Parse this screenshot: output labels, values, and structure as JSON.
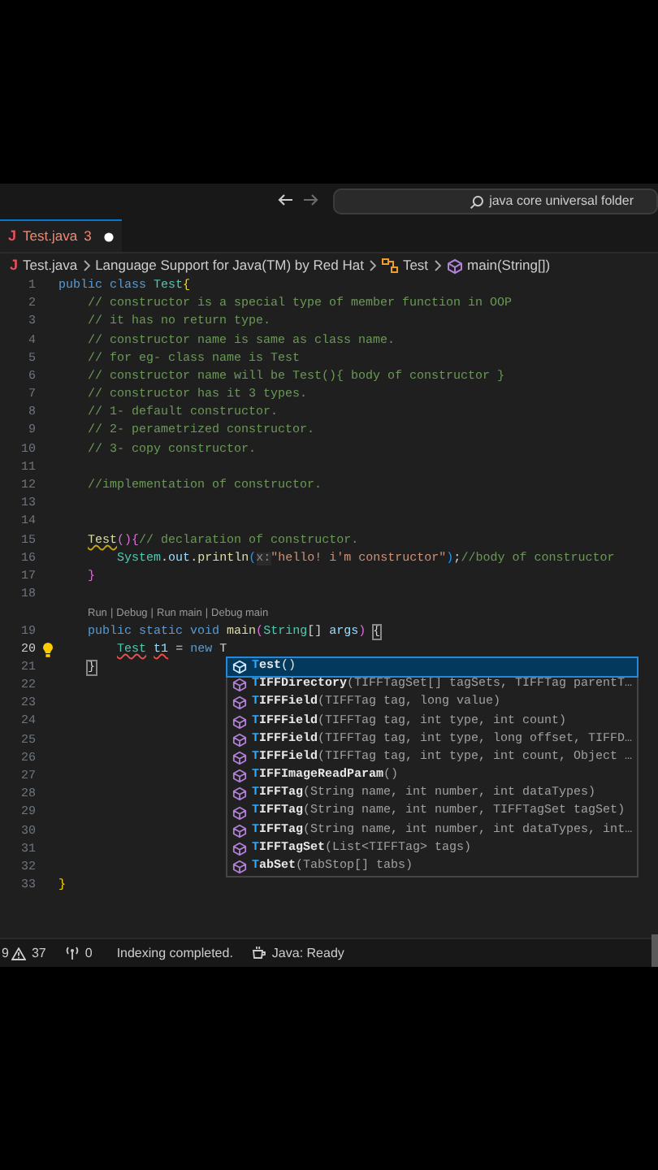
{
  "title_bar": {
    "nav": [
      {
        "kind": "back",
        "disabled": false
      },
      {
        "kind": "forward",
        "disabled": true
      }
    ],
    "search": {
      "value": "java core universal folder"
    }
  },
  "tabs": [
    {
      "icon_glyph": "J",
      "label": "Test.java",
      "badge": "3",
      "modified": true,
      "selected": true
    }
  ],
  "breadcrumb": [
    {
      "kind": "file",
      "icon_glyph": "J",
      "text": "Test.java"
    },
    {
      "kind": "text",
      "text": "Language Support for Java(TM) by Red Hat"
    },
    {
      "kind": "class",
      "text": "Test"
    },
    {
      "kind": "method",
      "text": "main(String[])"
    }
  ],
  "editor": {
    "lines": [
      {
        "kind": "code",
        "number": "1",
        "current": false,
        "lightbulb": false,
        "tokens": [
          {
            "text": "public class ",
            "kind": "keyword"
          },
          {
            "text": "Test",
            "kind": "type"
          },
          {
            "text": "{",
            "kind": "brace1"
          }
        ]
      },
      {
        "kind": "code",
        "number": "2",
        "current": false,
        "lightbulb": false,
        "tokens": [
          {
            "text": "    // constructor is a special type of member function in OOP",
            "kind": "comment"
          }
        ]
      },
      {
        "kind": "code",
        "number": "3",
        "current": false,
        "lightbulb": false,
        "tokens": [
          {
            "text": "    // it has no return type.",
            "kind": "comment"
          }
        ]
      },
      {
        "kind": "code",
        "number": "4",
        "current": false,
        "lightbulb": false,
        "tokens": [
          {
            "text": "    // constructor name is same as class name.",
            "kind": "comment"
          }
        ]
      },
      {
        "kind": "code",
        "number": "5",
        "current": false,
        "lightbulb": false,
        "tokens": [
          {
            "text": "    // for eg- class name is Test",
            "kind": "comment"
          }
        ]
      },
      {
        "kind": "code",
        "number": "6",
        "current": false,
        "lightbulb": false,
        "tokens": [
          {
            "text": "    // constructor name will be Test(){ body of constructor }",
            "kind": "comment"
          }
        ]
      },
      {
        "kind": "code",
        "number": "7",
        "current": false,
        "lightbulb": false,
        "tokens": [
          {
            "text": "    // constructor has it 3 types.",
            "kind": "comment"
          }
        ]
      },
      {
        "kind": "code",
        "number": "8",
        "current": false,
        "lightbulb": false,
        "tokens": [
          {
            "text": "    // 1- default constructor.",
            "kind": "comment"
          }
        ]
      },
      {
        "kind": "code",
        "number": "9",
        "current": false,
        "lightbulb": false,
        "tokens": [
          {
            "text": "    // 2- perametrized constructor.",
            "kind": "comment"
          }
        ]
      },
      {
        "kind": "code",
        "number": "10",
        "current": false,
        "lightbulb": false,
        "tokens": [
          {
            "text": "    // 3- copy constructor.",
            "kind": "comment"
          }
        ]
      },
      {
        "kind": "code",
        "number": "11",
        "current": false,
        "lightbulb": false
      },
      {
        "kind": "code",
        "number": "12",
        "current": false,
        "lightbulb": false,
        "tokens": [
          {
            "text": "    //implementation of constructor.",
            "kind": "comment"
          }
        ]
      },
      {
        "kind": "code",
        "number": "13",
        "current": false,
        "lightbulb": false
      },
      {
        "kind": "code",
        "number": "14",
        "current": false,
        "lightbulb": false
      },
      {
        "kind": "code",
        "number": "15",
        "current": false,
        "lightbulb": false,
        "tokens": [
          {
            "text": "    Test",
            "kind": "method",
            "squiggle": true,
            "color": "#cca700"
          },
          {
            "text": "(){",
            "kind": "brace2",
            "squiggle": false
          },
          {
            "text": "// declaration of constructor.",
            "kind": "comment",
            "squiggle": false
          }
        ]
      },
      {
        "kind": "code",
        "number": "16",
        "current": false,
        "lightbulb": false,
        "tokens": [
          {
            "text": "        System",
            "kind": "type"
          },
          {
            "text": ".",
            "kind": "plain"
          },
          {
            "text": "out",
            "kind": "field"
          },
          {
            "text": ".",
            "kind": "plain"
          },
          {
            "text": "println",
            "kind": "method"
          },
          {
            "text": "(",
            "kind": "brace3"
          },
          {
            "text": "x:",
            "kind": "hint"
          },
          {
            "text": "\"hello! i'm constructor\"",
            "kind": "string"
          },
          {
            "text": ")",
            "kind": "brace3"
          },
          {
            "text": ";",
            "kind": "plain"
          },
          {
            "text": "//body of constructor",
            "kind": "comment"
          }
        ]
      },
      {
        "kind": "code",
        "number": "17",
        "current": false,
        "lightbulb": false,
        "tokens": [
          {
            "text": "    }",
            "kind": "brace2"
          }
        ]
      },
      {
        "kind": "code",
        "number": "18",
        "current": false,
        "lightbulb": false
      },
      {
        "kind": "codelens",
        "links": [
          "Run",
          "Debug",
          "Run main",
          "Debug main"
        ],
        "separator": "|"
      },
      {
        "kind": "code",
        "number": "19",
        "current": false,
        "lightbulb": false,
        "tokens": [
          {
            "text": "    public static void ",
            "kind": "keyword"
          },
          {
            "text": "main",
            "kind": "method"
          },
          {
            "text": "(",
            "kind": "brace2"
          },
          {
            "text": "String",
            "kind": "type"
          },
          {
            "text": "[] ",
            "kind": "plain"
          },
          {
            "text": "args",
            "kind": "variable"
          },
          {
            "text": ") ",
            "kind": "brace2"
          },
          {
            "text": "{",
            "kind": "bracket-match"
          }
        ]
      },
      {
        "kind": "code",
        "number": "20",
        "current": true,
        "lightbulb": true,
        "tokens": [
          {
            "text": "        Test",
            "kind": "type",
            "squiggle": true,
            "color": "#f14c4c"
          },
          {
            "text": " t1",
            "kind": "variable",
            "squiggle": true,
            "color": "#f14c4c"
          },
          {
            "text": " = ",
            "kind": "plain",
            "squiggle": false
          },
          {
            "text": "new",
            "kind": "keyword",
            "squiggle": false
          },
          {
            "text": " T",
            "kind": "plain",
            "squiggle": false
          }
        ]
      },
      {
        "kind": "code",
        "number": "21",
        "current": false,
        "lightbulb": false,
        "tokens": [
          {
            "text": "    }",
            "kind": "bracket-match"
          }
        ]
      },
      {
        "kind": "code",
        "number": "22",
        "current": false,
        "lightbulb": false
      },
      {
        "kind": "code",
        "number": "23",
        "current": false,
        "lightbulb": false
      },
      {
        "kind": "code",
        "number": "24",
        "current": false,
        "lightbulb": false
      },
      {
        "kind": "code",
        "number": "25",
        "current": false,
        "lightbulb": false
      },
      {
        "kind": "code",
        "number": "26",
        "current": false,
        "lightbulb": false
      },
      {
        "kind": "code",
        "number": "27",
        "current": false,
        "lightbulb": false
      },
      {
        "kind": "code",
        "number": "28",
        "current": false,
        "lightbulb": false
      },
      {
        "kind": "code",
        "number": "29",
        "current": false,
        "lightbulb": false
      },
      {
        "kind": "code",
        "number": "30",
        "current": false,
        "lightbulb": false
      },
      {
        "kind": "code",
        "number": "31",
        "current": false,
        "lightbulb": false
      },
      {
        "kind": "code",
        "number": "32",
        "current": false,
        "lightbulb": false
      },
      {
        "kind": "code",
        "number": "33",
        "current": false,
        "lightbulb": false,
        "tokens": [
          {
            "text": "}",
            "kind": "brace1"
          }
        ]
      }
    ],
    "suggestions": [
      {
        "match": "T",
        "rest": "est",
        "params": "()",
        "selected": true
      },
      {
        "match": "T",
        "rest": "IFFDirectory",
        "params": "(TIFFTagSet[] tagSets, TIFFTag parentT…",
        "selected": false
      },
      {
        "match": "T",
        "rest": "IFFField",
        "params": "(TIFFTag tag, long value)",
        "selected": false
      },
      {
        "match": "T",
        "rest": "IFFField",
        "params": "(TIFFTag tag, int type, int count)",
        "selected": false
      },
      {
        "match": "T",
        "rest": "IFFField",
        "params": "(TIFFTag tag, int type, long offset, TIFFD…",
        "selected": false
      },
      {
        "match": "T",
        "rest": "IFFField",
        "params": "(TIFFTag tag, int type, int count, Object …",
        "selected": false
      },
      {
        "match": "T",
        "rest": "IFFImageReadParam",
        "params": "()",
        "selected": false
      },
      {
        "match": "T",
        "rest": "IFFTag",
        "params": "(String name, int number, int dataTypes)",
        "selected": false
      },
      {
        "match": "T",
        "rest": "IFFTag",
        "params": "(String name, int number, TIFFTagSet tagSet)",
        "selected": false
      },
      {
        "match": "T",
        "rest": "IFFTag",
        "params": "(String name, int number, int dataTypes, int…",
        "selected": false
      },
      {
        "match": "T",
        "rest": "IFFTagSet",
        "params": "(List<TIFFTag> tags)",
        "selected": false
      },
      {
        "match": "T",
        "rest": "abSet",
        "params": "(TabStop[] tabs)",
        "selected": false
      }
    ]
  },
  "status_bar": [
    {
      "kind": "count",
      "text": "9"
    },
    {
      "kind": "warnings",
      "text": "37"
    },
    {
      "kind": "ports",
      "text": "0"
    },
    {
      "kind": "text",
      "text": "Indexing completed."
    },
    {
      "kind": "java",
      "text": "Java: Ready"
    }
  ]
}
